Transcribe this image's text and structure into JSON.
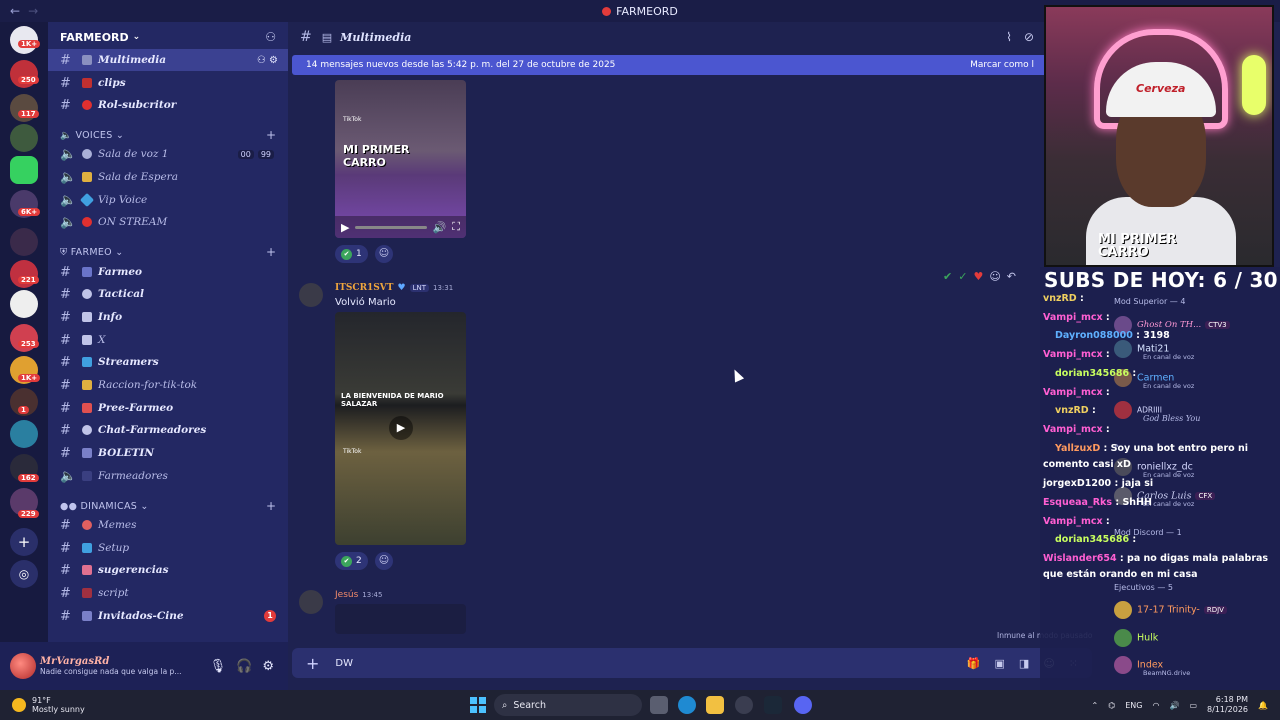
{
  "window": {
    "title": "FARMEORD"
  },
  "server": {
    "name": "FARMEORD"
  },
  "rail": {
    "badges": [
      "1K+",
      "250",
      "117",
      "6K+",
      "221",
      "253",
      "1K+",
      "1",
      "162",
      "229"
    ]
  },
  "sidebar": {
    "top_channels": [
      {
        "label": "Multimedia"
      },
      {
        "label": "clips"
      },
      {
        "label": "Rol-subcritor"
      }
    ],
    "categories": {
      "voices": "VOICES",
      "farmeo": "FARMEO",
      "dinamicas": "DINAMICAS"
    },
    "voice_channels": [
      {
        "label": "Sala de voz 1",
        "count_a": "00",
        "count_b": "99"
      },
      {
        "label": "Sala de Espera"
      },
      {
        "label": "Vip Voice"
      },
      {
        "label": "ON STREAM"
      }
    ],
    "farmeo_channels": [
      {
        "label": "Farmeo"
      },
      {
        "label": "Tactical"
      },
      {
        "label": "Info"
      },
      {
        "label": "X"
      },
      {
        "label": "Streamers"
      },
      {
        "label": "Raccion-for-tik-tok"
      },
      {
        "label": "Pree-Farmeo"
      },
      {
        "label": "Chat-Farmeadores"
      },
      {
        "label": "BOLETIN"
      },
      {
        "label": "Farmeadores"
      }
    ],
    "dinamicas_channels": [
      {
        "label": "Memes"
      },
      {
        "label": "Setup"
      },
      {
        "label": "sugerencias"
      },
      {
        "label": "script"
      },
      {
        "label": "Invitados-Cine",
        "badge": "1"
      }
    ]
  },
  "user": {
    "name": "MrVargasRd",
    "status": "Nadie consigue nada que valga la p..."
  },
  "chat": {
    "channel": "Multimedia",
    "new_banner": "14 mensajes nuevos desde las 5:42 p. m. del 27 de octubre de 2025",
    "mark_read": "Marcar como l",
    "media1": {
      "tiktok": "TikTok",
      "overlay": "MI PRIMER\nCARRO"
    },
    "reactions1": "1",
    "msg2": {
      "author": "ITSCR1SVT",
      "tag": "LNT",
      "time": "13:31",
      "text": "Volvió Mario"
    },
    "media2": {
      "caption": "LA BIENVENIDA DE MARIO SALAZAR",
      "tiktok": "TikTok"
    },
    "reactions2": "2",
    "msg3": {
      "author": "Jesús",
      "time": "13:45"
    },
    "input_value": "DW",
    "immune": "Inmune al modo pausado"
  },
  "overlay": {
    "cam_caption": "MI PRIMER\nCARRO",
    "cap_brand": "Cerveza",
    "subs": "SUBS DE HOY: 6 / 30",
    "chat": [
      {
        "user": "vnzRD",
        "color": "#f0d060",
        "text": ""
      },
      {
        "user": "Vampi_mcx",
        "color": "#ff5fd2",
        "text": ""
      },
      {
        "user": "Dayron088000",
        "color": "#5fb0ff",
        "text": "3198"
      },
      {
        "user": "Vampi_mcx",
        "color": "#ff5fd2",
        "text": ""
      },
      {
        "user": "dorian345686",
        "color": "#c8ff5f",
        "text": ""
      },
      {
        "user": "Vampi_mcx",
        "color": "#ff5fd2",
        "text": ""
      },
      {
        "user": "vnzRD",
        "color": "#f0d060",
        "text": ""
      },
      {
        "user": "Vampi_mcx",
        "color": "#ff5fd2",
        "text": ""
      },
      {
        "user": "YallzuxD",
        "color": "#ff9a5f",
        "text": "Soy una bot entro pero ni comento casi xD"
      },
      {
        "user": "jorgexD1200",
        "color": "#ffffff",
        "text": "jaja si"
      },
      {
        "user": "Esqueaa_Rks",
        "color": "#ff5fd2",
        "text": "ShHH"
      },
      {
        "user": "Vampi_mcx",
        "color": "#ff5fd2",
        "text": ""
      },
      {
        "user": "dorian345686",
        "color": "#c8ff5f",
        "text": ""
      },
      {
        "user": "Wislander654",
        "color": "#ff5fd2",
        "text": "pa no digas mala palabras que están orando en mi casa"
      }
    ],
    "members": [
      {
        "name": "Ghost On TH...",
        "tag": "CTV3",
        "sub": ""
      },
      {
        "name": "Mati21",
        "sub": "En canal de voz"
      },
      {
        "name": "Carmen",
        "sub": "En canal de voz"
      },
      {
        "name": "ADRIIII",
        "sub": "God Bless You"
      },
      {
        "name": "roniellxz_dc",
        "sub": "En canal de voz"
      },
      {
        "name": "Carlos Luis",
        "tag": "CFX",
        "sub": "En canal de voz"
      },
      {
        "name": "17-17 Trinity-",
        "tag": "RDJV",
        "sub": ""
      },
      {
        "name": "Hulk",
        "sub": ""
      },
      {
        "name": "Index",
        "sub": "BeamNG.drive"
      }
    ],
    "member_cats": [
      "Mod Superior — 4",
      "Mod Discord — 1",
      "Ejecutivos — 5"
    ]
  },
  "taskbar": {
    "temp": "91°F",
    "weather": "Mostly sunny",
    "search": "Search",
    "lang": "ENG",
    "time": "6:18 PM",
    "date": "8/11/2026"
  }
}
